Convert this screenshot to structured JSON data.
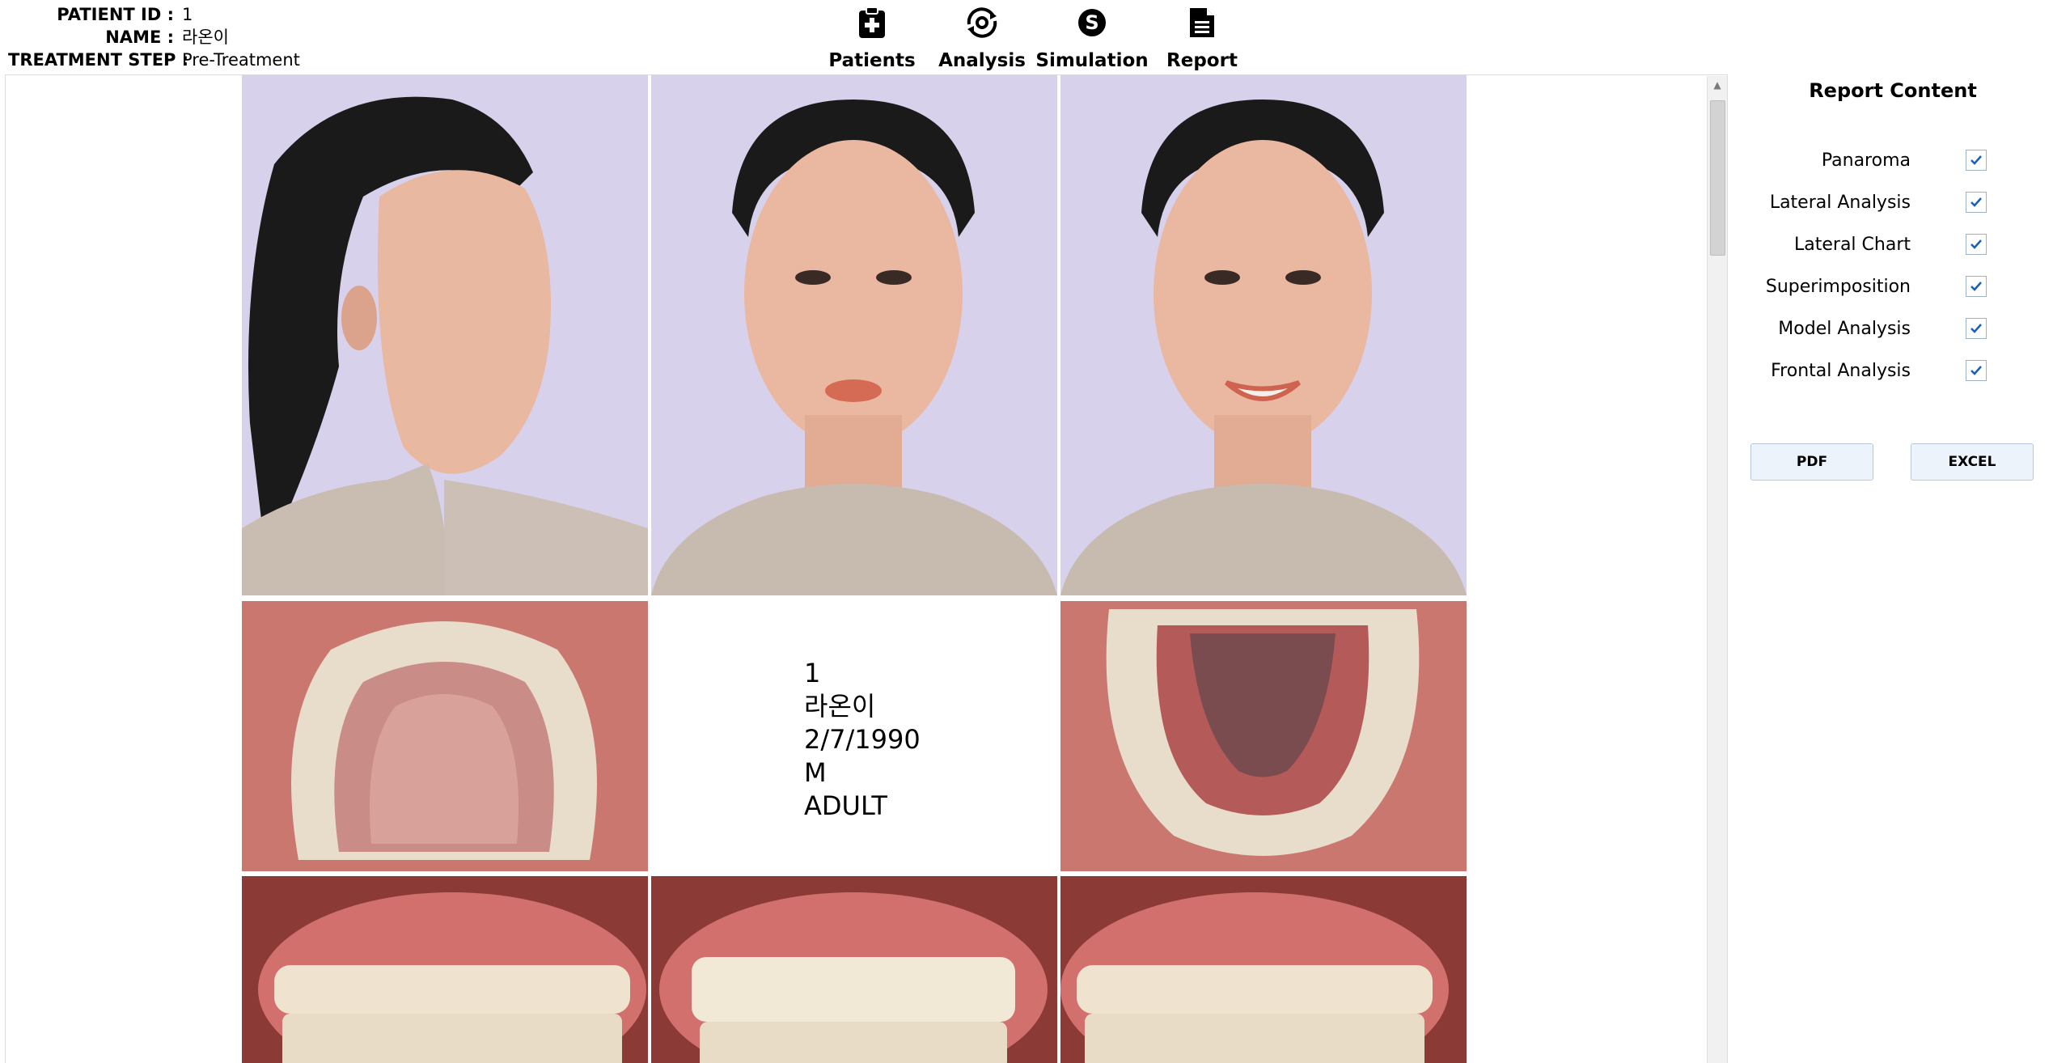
{
  "patient": {
    "id_label": "PATIENT ID :",
    "id_value": "1",
    "name_label": "NAME :",
    "name_value": "라온이",
    "step_label": "TREATMENT STEP :",
    "step_value": "Pre-Treatment"
  },
  "nav": {
    "items": [
      {
        "label": "Patients",
        "icon": "clipboard-plus-icon"
      },
      {
        "label": "Analysis",
        "icon": "analysis-eye-icon"
      },
      {
        "label": "Simulation",
        "icon": "simulation-s-icon"
      },
      {
        "label": "Report",
        "icon": "document-icon"
      }
    ]
  },
  "report": {
    "photos": [
      "profile-face-photo",
      "frontal-face-photo",
      "smiling-face-photo",
      "upper-occlusal-photo",
      "lower-occlusal-photo",
      "right-buccal-photo",
      "frontal-occlusion-photo",
      "left-buccal-photo"
    ],
    "info_card": {
      "id": "1",
      "name": "라온이",
      "dob": "2/7/1990",
      "sex": "M",
      "age_group": "ADULT"
    }
  },
  "right_panel": {
    "title": "Report Content",
    "options": [
      {
        "label": "Panaroma",
        "checked": true
      },
      {
        "label": "Lateral Analysis",
        "checked": true
      },
      {
        "label": "Lateral Chart",
        "checked": true
      },
      {
        "label": "Superimposition",
        "checked": true
      },
      {
        "label": "Model Analysis",
        "checked": true
      },
      {
        "label": "Frontal Analysis",
        "checked": true
      }
    ],
    "pdf_label": "PDF",
    "excel_label": "EXCEL"
  },
  "colors": {
    "face_background": "#d7d0ea",
    "occlusal_background": "#d9908a",
    "teeth_background": "#b84a4a",
    "checkbox_accent": "#1a5fb4",
    "button_background": "#edf3fb"
  }
}
